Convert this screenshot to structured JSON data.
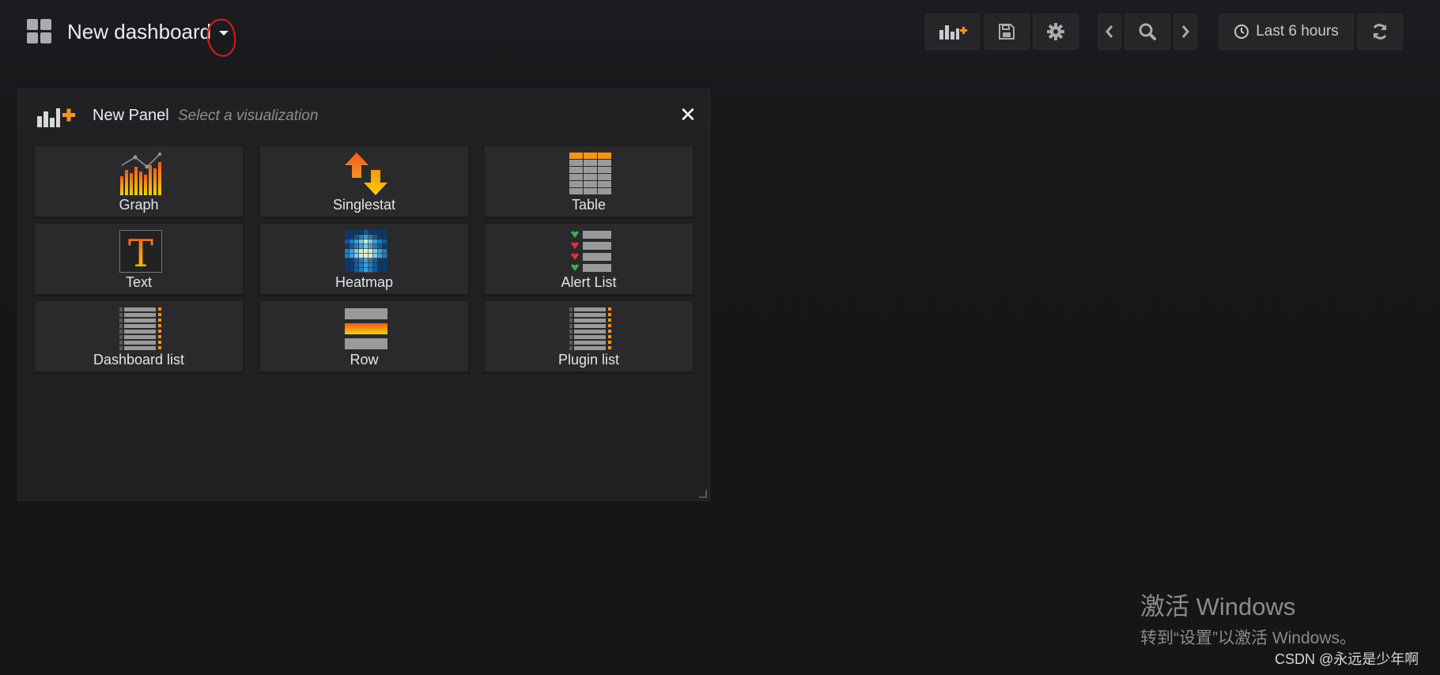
{
  "navbar": {
    "dashboard_title": "New dashboard",
    "time_range_label": "Last 6 hours",
    "buttons": [
      "add-panel",
      "save",
      "settings",
      "time-back",
      "zoom-out",
      "time-forward",
      "time-range",
      "refresh"
    ]
  },
  "panel": {
    "title": "New Panel",
    "subtitle": "Select a visualization",
    "visualizations": [
      {
        "label": "Graph",
        "icon": "graph-icon"
      },
      {
        "label": "Singlestat",
        "icon": "singlestat-icon"
      },
      {
        "label": "Table",
        "icon": "table-icon"
      },
      {
        "label": "Text",
        "icon": "text-icon"
      },
      {
        "label": "Heatmap",
        "icon": "heatmap-icon"
      },
      {
        "label": "Alert List",
        "icon": "alert-list-icon"
      },
      {
        "label": "Dashboard list",
        "icon": "dashboard-list-icon"
      },
      {
        "label": "Row",
        "icon": "row-icon"
      },
      {
        "label": "Plugin list",
        "icon": "plugin-list-icon"
      }
    ]
  },
  "overlay": {
    "windows_activation_title": "激活 Windows",
    "windows_activation_subtitle": "转到“设置”以激活 Windows。",
    "watermark": "CSDN @永远是少年啊"
  },
  "colors": {
    "background": "#161719",
    "panel_bg": "#212124",
    "card_bg": "#2a2a2c",
    "accent_orange": "#f7941d",
    "annotation_red": "#e5161c"
  }
}
